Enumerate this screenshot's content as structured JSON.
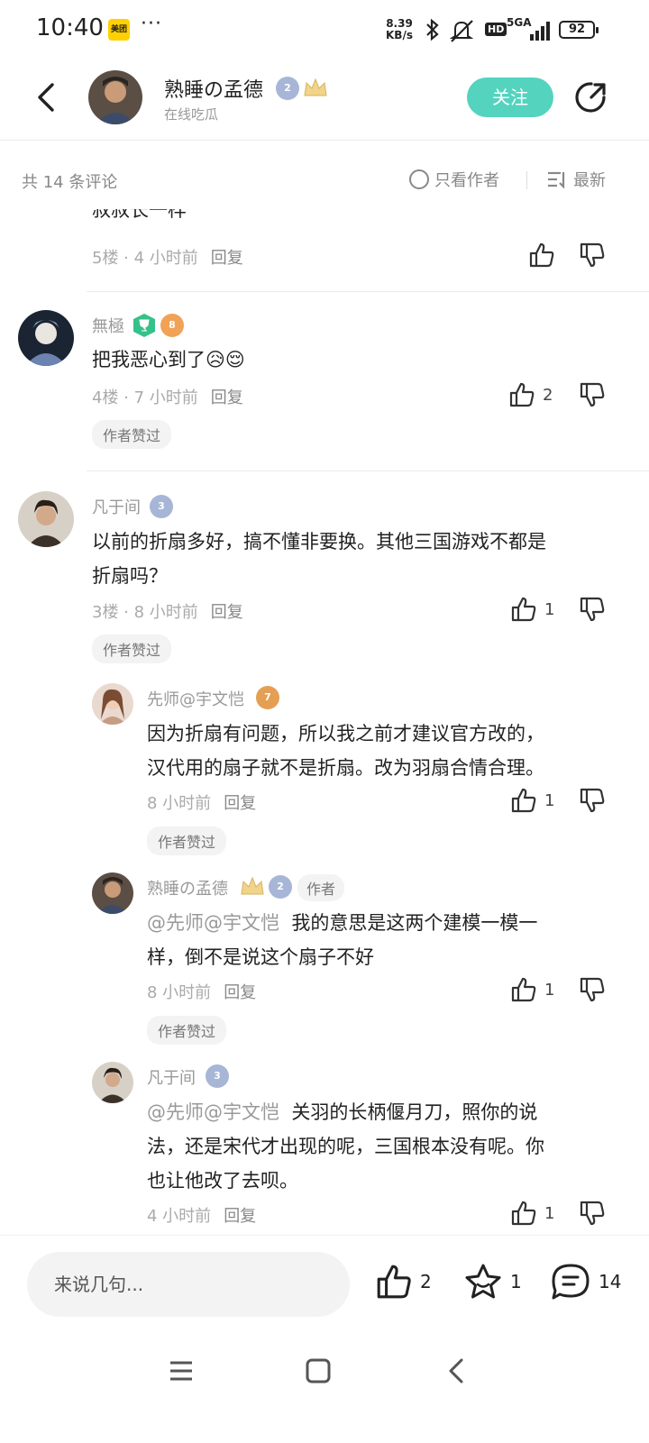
{
  "status_bar": {
    "time": "10:40",
    "app_logo_text": "美团",
    "more": "···",
    "net_speed_value": "8.39",
    "net_speed_unit": "KB/s",
    "hd_label": "HD",
    "network": "5GA",
    "battery": "92"
  },
  "header": {
    "author_name": "熟睡の孟德",
    "author_subtitle": "在线吃瓜",
    "level_badge": "2",
    "follow_label": "关注"
  },
  "filter_bar": {
    "count_label": "共 14 条评论",
    "only_author_label": "只看作者",
    "sort_label": "最新"
  },
  "comments": [
    {
      "partial_text": "叔叔长一样",
      "meta_floor": "5楼 · 4 小时前",
      "reply_label": "回复",
      "likes": ""
    },
    {
      "username": "無極",
      "level": "8",
      "text": "把我恶心到了",
      "emojis": "😥😌",
      "meta_floor": "4楼 · 7 小时前",
      "reply_label": "回复",
      "likes": "2",
      "chip": "作者赞过"
    },
    {
      "username": "凡于间",
      "level": "3",
      "text_line1": "以前的折扇多好，搞不懂非要换。其他三国游戏不都是",
      "text_line2": "折扇吗？",
      "meta_floor": "3楼 · 8 小时前",
      "reply_label": "回复",
      "likes": "1",
      "chip": "作者赞过"
    }
  ],
  "replies": [
    {
      "username": "先师@宇文恺",
      "level": "7",
      "text_line1": "因为折扇有问题，所以我之前才建议官方改的，",
      "text_line2": "汉代用的扇子就不是折扇。改为羽扇合情合理。",
      "meta_time": "8 小时前",
      "reply_label": "回复",
      "likes": "1",
      "chip": "作者赞过"
    },
    {
      "username": "熟睡の孟德",
      "level": "2",
      "author_tag": "作者",
      "mention": "@先师@宇文恺",
      "text_line1": "我的意思是这两个建模一模一",
      "text_line2": "样，倒不是说这个扇子不好",
      "meta_time": "8 小时前",
      "reply_label": "回复",
      "likes": "1",
      "chip": "作者赞过"
    },
    {
      "username": "凡于间",
      "level": "3",
      "mention": "@先师@宇文恺",
      "text_line1": "关羽的长柄偃月刀，照你的说",
      "text_line2": "法，还是宋代才出现的呢，三国根本没有呢。你",
      "text_line3": "也让他改了去呗。",
      "meta_time": "4 小时前",
      "reply_label": "回复",
      "likes": "1"
    }
  ],
  "bottom_bar": {
    "input_placeholder": "来说几句...",
    "like_count": "2",
    "fav_count": "1",
    "comment_count": "14"
  },
  "colors": {
    "accent": "#54d3bf",
    "gold": "#e3b341"
  }
}
